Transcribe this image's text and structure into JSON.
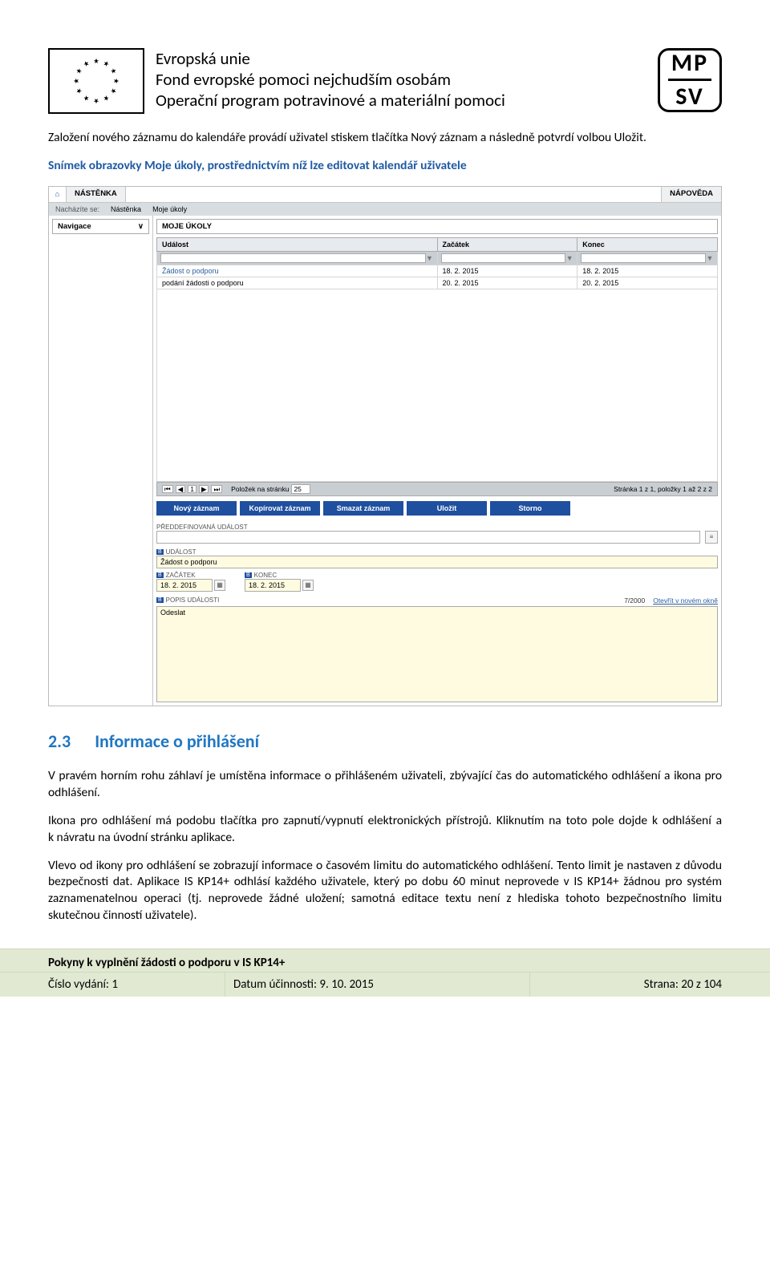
{
  "header": {
    "line1": "Evropská unie",
    "line2": "Fond evropské pomoci nejchudším osobám",
    "line3": "Operační program potravinové a materiální pomoci",
    "mpsv_top": "MP",
    "mpsv_bottom": "SV"
  },
  "para1": "Založení nového záznamu do kalendáře provádí uživatel stiskem tlačítka Nový záznam a následně potvrdí volbou Uložit.",
  "caption1": "Snímek obrazovky Moje úkoly, prostřednictvím níž lze editovat kalendář uživatele",
  "section_num": "2.3",
  "section_title": "Informace o přihlášení",
  "para2": "V pravém horním rohu záhlaví je umístěna informace o přihlášeném uživateli, zbývající čas do automatického odhlášení a ikona pro odhlášení.",
  "para3": "Ikona pro odhlášení má podobu tlačítka pro zapnutí/vypnutí elektronických přístrojů. Kliknutím na toto pole dojde k odhlášení a k návratu na úvodní stránku aplikace.",
  "para4": "Vlevo od ikony pro odhlášení se zobrazují informace o časovém limitu do automatického odhlášení. Tento limit je nastaven z důvodu bezpečnosti dat. Aplikace IS KP14+ odhlásí každého uživatele, který po dobu 60 minut neprovede v IS KP14+ žádnou pro systém zaznamenatelnou operaci (tj. neprovede žádné uložení; samotná editace textu není z hlediska tohoto bezpečnostního limitu skutečnou činností uživatele).",
  "app": {
    "tab_main": "NÁSTĚNKA",
    "tab_help": "NÁPOVĚDA",
    "breadcrumb_label": "Nacházíte se:",
    "breadcrumb_1": "Nástěnka",
    "breadcrumb_2": "Moje úkoly",
    "nav_header": "Navigace",
    "section": "MOJE ÚKOLY",
    "cols": {
      "c1": "Událost",
      "c2": "Začátek",
      "c3": "Konec"
    },
    "rows": [
      {
        "event": "Žádost o podporu",
        "start": "18. 2. 2015",
        "end": "18. 2. 2015"
      },
      {
        "event": "podání žádosti o podporu",
        "start": "20. 2. 2015",
        "end": "20. 2. 2015"
      }
    ],
    "pager_items_label": "Položek na stránku",
    "pager_items_value": "25",
    "pager_info": "Stránka 1 z 1, položky 1 až 2 z 2",
    "buttons": {
      "new": "Nový záznam",
      "copy": "Kopírovat záznam",
      "delete": "Smazat záznam",
      "save": "Uložit",
      "cancel": "Storno"
    },
    "form": {
      "predef_label": "PŘEDDEFINOVANÁ UDÁLOST",
      "event_label": "UDÁLOST",
      "event_value": "Žádost o podporu",
      "start_label": "ZAČÁTEK",
      "start_value": "18. 2. 2015",
      "end_label": "KONEC",
      "end_value": "18. 2. 2015",
      "desc_label": "POPIS UDÁLOSTI",
      "desc_counter": "7/2000",
      "desc_link": "Otevřít v novém okně",
      "desc_value": "Odeslat"
    }
  },
  "footer": {
    "title": "Pokyny k vyplnění žádosti o podporu v IS KP14+",
    "issue_label": "Číslo vydání: 1",
    "date_label": "Datum účinnosti: 9. 10. 2015",
    "page_label": "Strana: 20 z 104"
  }
}
